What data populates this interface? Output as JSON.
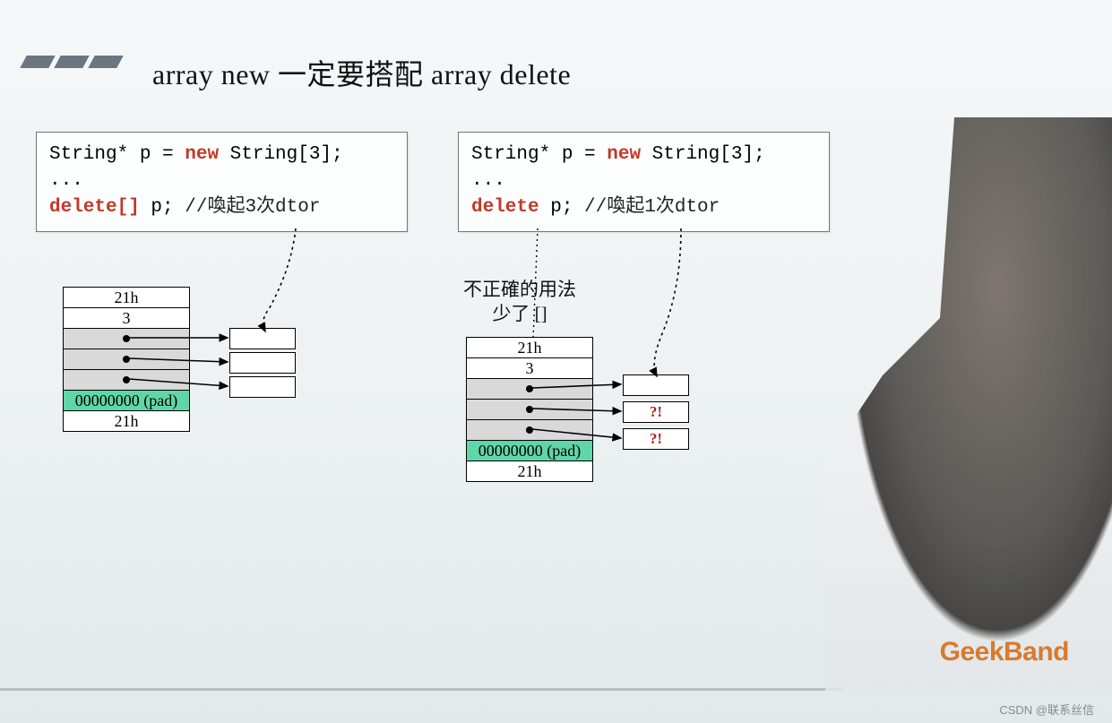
{
  "title": "array new 一定要搭配 array delete",
  "left_code": {
    "line1_pre": "String* p = ",
    "line1_new": "new",
    "line1_post": " String[3];",
    "line2": "...",
    "line3_del": "delete[]",
    "line3_post": " p;",
    "line3_comment": " //喚起3次dtor"
  },
  "right_code": {
    "line1_pre": "String* p = ",
    "line1_new": "new",
    "line1_post": " String[3];",
    "line2": "...",
    "line3_del": "delete",
    "line3_post": " p;",
    "line3_comment": " //喚起1次dtor"
  },
  "note": {
    "line1": "不正確的用法",
    "line2": "少了 []"
  },
  "mem_left": {
    "hdr_top": "21h",
    "count": "3",
    "pad": "00000000 (pad)",
    "hdr_bot": "21h"
  },
  "mem_right": {
    "hdr_top": "21h",
    "count": "3",
    "pad": "00000000 (pad)",
    "hdr_bot": "21h",
    "warn1": "?!",
    "warn2": "?!"
  },
  "watermark": "GeekBand",
  "csdn": "CSDN @联系丝信"
}
